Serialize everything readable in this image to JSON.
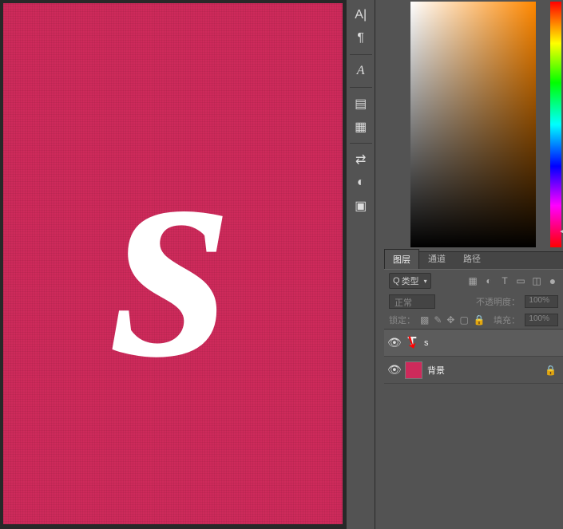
{
  "canvas": {
    "letter": "s",
    "bgcolor": "#ce2a5b"
  },
  "toolbar": {
    "icons": [
      "character",
      "paragraph",
      "glyphs",
      "paragraph-styles",
      "character-styles",
      "adjustments",
      "styles",
      "layer-comps"
    ]
  },
  "panel": {
    "tabs": {
      "layers": "图层",
      "channels": "通道",
      "paths": "路径"
    },
    "search_prefix": "Q",
    "kind_label": "类型",
    "blend_mode": "正常",
    "opacity_label": "不透明度：",
    "opacity_value": "100%",
    "lock_label": "锁定：",
    "fill_label": "填充：",
    "fill_value": "100%"
  },
  "layers": [
    {
      "name": "s",
      "type": "text",
      "visible": true,
      "locked": false
    },
    {
      "name": "背景",
      "type": "bg",
      "visible": true,
      "locked": true
    }
  ]
}
